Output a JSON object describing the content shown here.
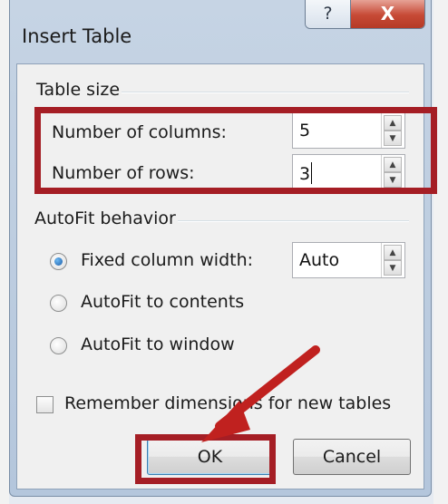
{
  "dialog": {
    "title": "Insert Table",
    "help_glyph": "?",
    "close_glyph": "X"
  },
  "table_size": {
    "group_label": "Table size",
    "columns_label": "Number of columns:",
    "columns_value": "5",
    "rows_label": "Number of rows:",
    "rows_value": "3"
  },
  "autofit": {
    "group_label": "AutoFit behavior",
    "options": [
      {
        "label": "Fixed column width:",
        "selected": true
      },
      {
        "label": "AutoFit to contents",
        "selected": false
      },
      {
        "label": "AutoFit to window",
        "selected": false
      }
    ],
    "fixed_width_value": "Auto"
  },
  "remember": {
    "label": "Remember dimensions for new tables",
    "checked": false
  },
  "buttons": {
    "ok": "OK",
    "cancel": "Cancel"
  },
  "annotation": {
    "highlight_color": "#a51e25",
    "arrow_color": "#c0211f"
  },
  "icons": {
    "spin_up": "spin-up-arrow-icon",
    "spin_down": "spin-down-arrow-icon",
    "close": "close-x-icon",
    "help": "help-question-icon"
  }
}
